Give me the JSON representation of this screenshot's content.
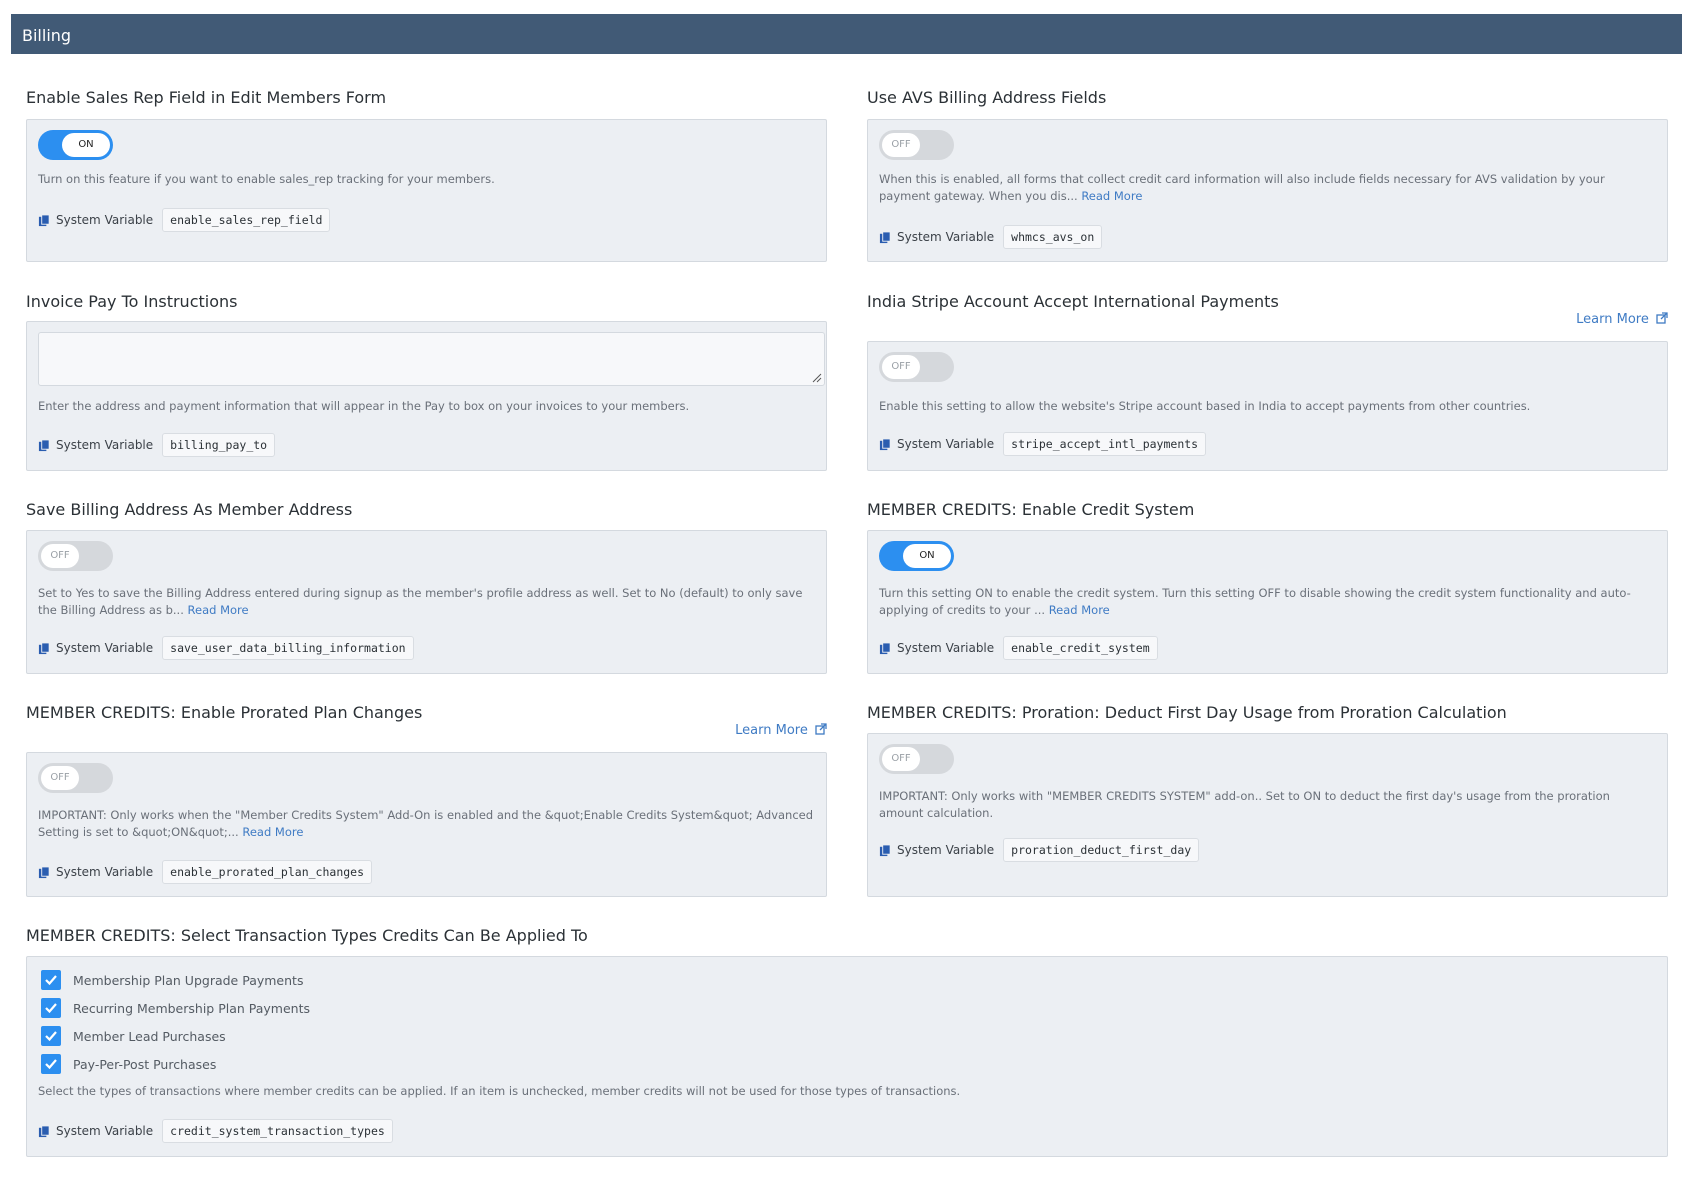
{
  "header": {
    "title": "Billing"
  },
  "colors": {
    "header_bg": "#415a76",
    "toggle_on": "#2c8ff0",
    "toggle_off": "#d5d8dc",
    "link": "#3f7bc4",
    "panel_bg": "#eceff3"
  },
  "settings": {
    "sales_rep": {
      "title": "Enable Sales Rep Field in Edit Members Form",
      "toggle": "ON",
      "description": "Turn on this feature if you want to enable sales_rep tracking for your members.",
      "sysvar_label": "System Variable",
      "sysvar": "enable_sales_rep_field"
    },
    "avs": {
      "title": "Use AVS Billing Address Fields",
      "toggle": "OFF",
      "description": "When this is enabled, all forms that collect credit card information will also include fields necessary for AVS validation by your payment gateway. When you dis...",
      "read_more": "Read More",
      "sysvar_label": "System Variable",
      "sysvar": "whmcs_avs_on"
    },
    "pay_to": {
      "title": "Invoice Pay To Instructions",
      "value": "",
      "description": "Enter the address and payment information that will appear in the Pay to box on your invoices to your members.",
      "sysvar_label": "System Variable",
      "sysvar": "billing_pay_to"
    },
    "stripe_intl": {
      "title": "India Stripe Account Accept International Payments",
      "learn_more": "Learn More",
      "toggle": "OFF",
      "description": "Enable this setting to allow the website's Stripe account based in India to accept payments from other countries.",
      "sysvar_label": "System Variable",
      "sysvar": "stripe_accept_intl_payments"
    },
    "save_billing": {
      "title": "Save Billing Address As Member Address",
      "toggle": "OFF",
      "description": "Set to Yes to save the Billing Address entered during signup as the member's profile address as well.  Set to No (default) to only save the Billing Address as b...",
      "read_more": "Read More",
      "sysvar_label": "System Variable",
      "sysvar": "save_user_data_billing_information"
    },
    "credit_system": {
      "title": "MEMBER CREDITS: Enable Credit System",
      "toggle": "ON",
      "description": "Turn this setting ON to enable the credit system. Turn this setting OFF to disable showing the credit system functionality and auto-applying of credits to your ...",
      "read_more": "Read More",
      "sysvar_label": "System Variable",
      "sysvar": "enable_credit_system"
    },
    "prorated": {
      "title": "MEMBER CREDITS: Enable Prorated Plan Changes",
      "learn_more": "Learn More",
      "toggle": "OFF",
      "description": "IMPORTANT: Only works when the \"Member Credits System\" Add-On is enabled and the &quot;Enable Credits System&quot; Advanced Setting is set to &quot;ON&quot;...",
      "read_more": "Read More",
      "sysvar_label": "System Variable",
      "sysvar": "enable_prorated_plan_changes"
    },
    "proration_first_day": {
      "title": "MEMBER CREDITS: Proration: Deduct First Day Usage from Proration Calculation",
      "toggle": "OFF",
      "description": "IMPORTANT: Only works with \"MEMBER CREDITS SYSTEM\" add-on.. Set to ON to deduct the first day's usage from the proration amount calculation.",
      "sysvar_label": "System Variable",
      "sysvar": "proration_deduct_first_day"
    },
    "transaction_types": {
      "title": "MEMBER CREDITS: Select Transaction Types Credits Can Be Applied To",
      "options": [
        {
          "label": "Membership Plan Upgrade Payments",
          "checked": true
        },
        {
          "label": "Recurring Membership Plan Payments",
          "checked": true
        },
        {
          "label": "Member Lead Purchases",
          "checked": true
        },
        {
          "label": "Pay-Per-Post Purchases",
          "checked": true
        }
      ],
      "description": "Select the types of transactions where member credits can be applied. If an item is unchecked, member credits will not be used for those types of transactions.",
      "sysvar_label": "System Variable",
      "sysvar": "credit_system_transaction_types"
    }
  }
}
